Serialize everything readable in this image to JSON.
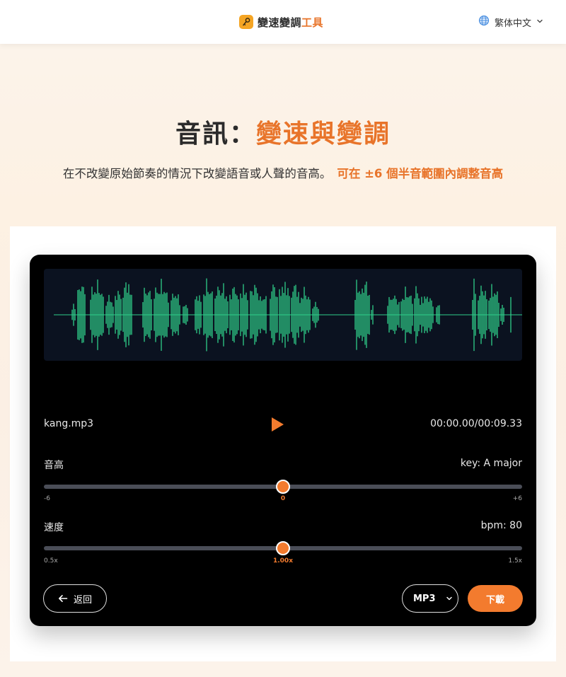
{
  "header": {
    "brand_part1": "變速變調",
    "brand_part2": "工具",
    "language": "繁体中文",
    "icons": [
      "key-logo-icon",
      "globe-icon",
      "chevron-down-icon"
    ]
  },
  "hero": {
    "title_prefix": "音訊：",
    "title_highlight": "變速與變調",
    "subtitle": "在不改變原始節奏的情況下改變語音或人聲的音高。",
    "subtitle_highlight": "可在 ±6 個半音範圍內調整音高"
  },
  "player": {
    "file_name": "kang.mp3",
    "time": "00:00.00/00:09.33",
    "icons": [
      "play-icon"
    ]
  },
  "pitch": {
    "label": "音高",
    "info": "key: A major",
    "min_label": "-6",
    "max_label": "+6",
    "value_label": "0",
    "min": -6,
    "max": 6,
    "value": 0
  },
  "speed": {
    "label": "速度",
    "info": "bpm: 80",
    "min_label": "0.5x",
    "max_label": "1.5x",
    "value_label": "1.00x",
    "min": 0.5,
    "max": 1.5,
    "value": 1.0
  },
  "actions": {
    "back_label": "返回",
    "format_value": "MP3",
    "download_label": "下載",
    "icons": [
      "arrow-left-icon",
      "chevron-down-icon"
    ]
  },
  "colors": {
    "accent": "#f37b2e",
    "accent_text": "#e8742a",
    "waveform": "#2fcf8a",
    "waveform_bg": "#0b1220",
    "card_bg": "#000000"
  }
}
